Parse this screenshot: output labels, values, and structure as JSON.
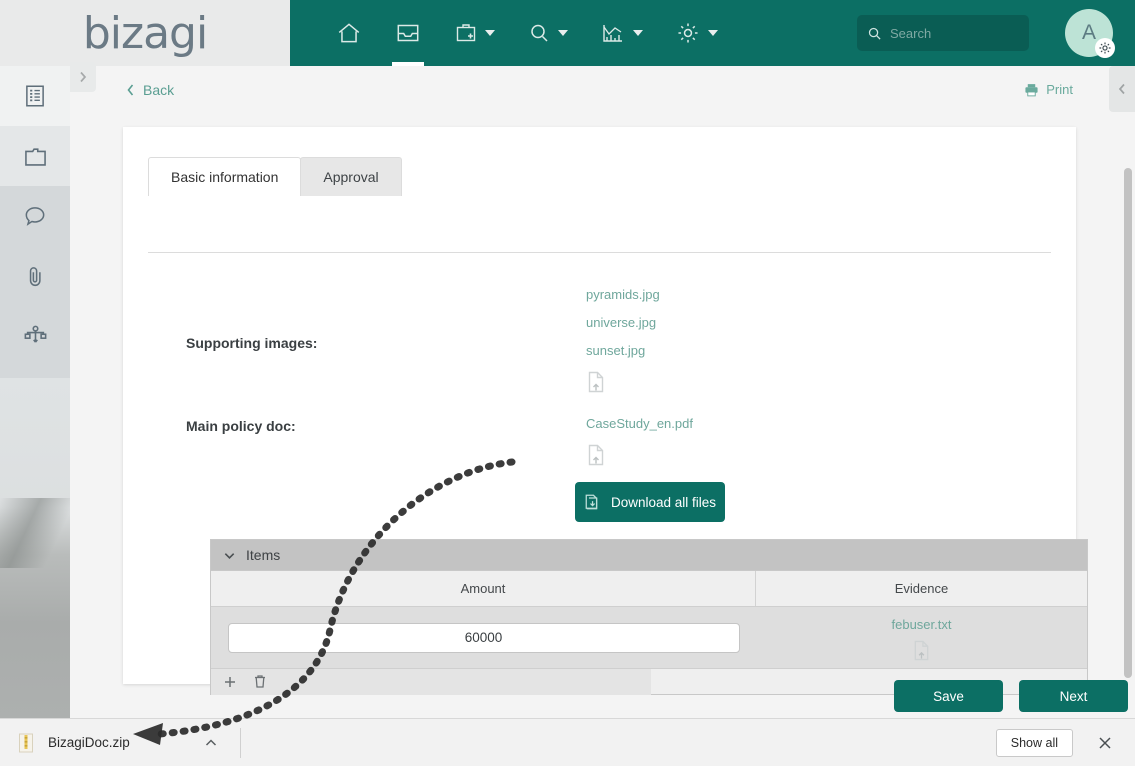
{
  "header": {
    "logo_text": "bizagi",
    "nav_items": [
      {
        "label": "Home",
        "icon": "home-icon",
        "caret": false,
        "active": false
      },
      {
        "label": "Inbox",
        "icon": "inbox-icon",
        "caret": false,
        "active": true
      },
      {
        "label": "New case",
        "icon": "briefcase-plus-icon",
        "caret": true,
        "active": false
      },
      {
        "label": "Search",
        "icon": "magnifier-icon",
        "caret": true,
        "active": false
      },
      {
        "label": "Analytics",
        "icon": "chart-icon",
        "caret": true,
        "active": false
      },
      {
        "label": "Settings",
        "icon": "gear-icon",
        "caret": true,
        "active": false
      }
    ],
    "search_placeholder": "Search",
    "search_value": "",
    "avatar_initial": "A",
    "accent_color": "#0c6f64"
  },
  "sidebar": {
    "expander_icon": "chevron-right-icon",
    "items": [
      {
        "icon": "form-icon",
        "label": "Form"
      },
      {
        "icon": "folder-icon",
        "label": "Documents"
      },
      {
        "icon": "comment-icon",
        "label": "Comments"
      },
      {
        "icon": "paperclip-icon",
        "label": "Attachments"
      },
      {
        "icon": "process-diagram-icon",
        "label": "Process"
      }
    ]
  },
  "topbar": {
    "back_label": "Back",
    "back_icon": "chevron-left-icon",
    "print_label": "Print",
    "print_icon": "printer-icon",
    "collapse_icon": "chevron-left-icon"
  },
  "form": {
    "tabs": [
      {
        "label": "Basic information",
        "active": true
      },
      {
        "label": "Approval",
        "active": false
      }
    ],
    "fields": [
      {
        "label": "Supporting images:",
        "files": [
          "pyramids.jpg",
          "universe.jpg",
          "sunset.jpg"
        ],
        "upload_icon": "file-upload-icon"
      },
      {
        "label": "Main policy doc:",
        "files": [
          "CaseStudy_en.pdf"
        ],
        "upload_icon": "file-upload-icon"
      }
    ],
    "download_all_button": {
      "label": "Download all files",
      "icon": "download-files-icon"
    }
  },
  "grid": {
    "title": "Items",
    "collapse_icon": "chevron-down-icon",
    "columns": [
      "Amount",
      "Evidence"
    ],
    "rows": [
      {
        "amount": "60000",
        "evidence_file": "febuser.txt",
        "evidence_icon": "file-upload-icon"
      }
    ],
    "footer_actions": [
      {
        "icon": "plus-icon",
        "label": "Add row"
      },
      {
        "icon": "trash-icon",
        "label": "Delete row"
      }
    ]
  },
  "footer": {
    "save_label": "Save",
    "next_label": "Next"
  },
  "download_bar": {
    "file_name": "BizagiDoc.zip",
    "file_icon": "zip-file-icon",
    "expand_icon": "chevron-up-icon",
    "show_all_label": "Show all",
    "close_icon": "close-icon"
  }
}
